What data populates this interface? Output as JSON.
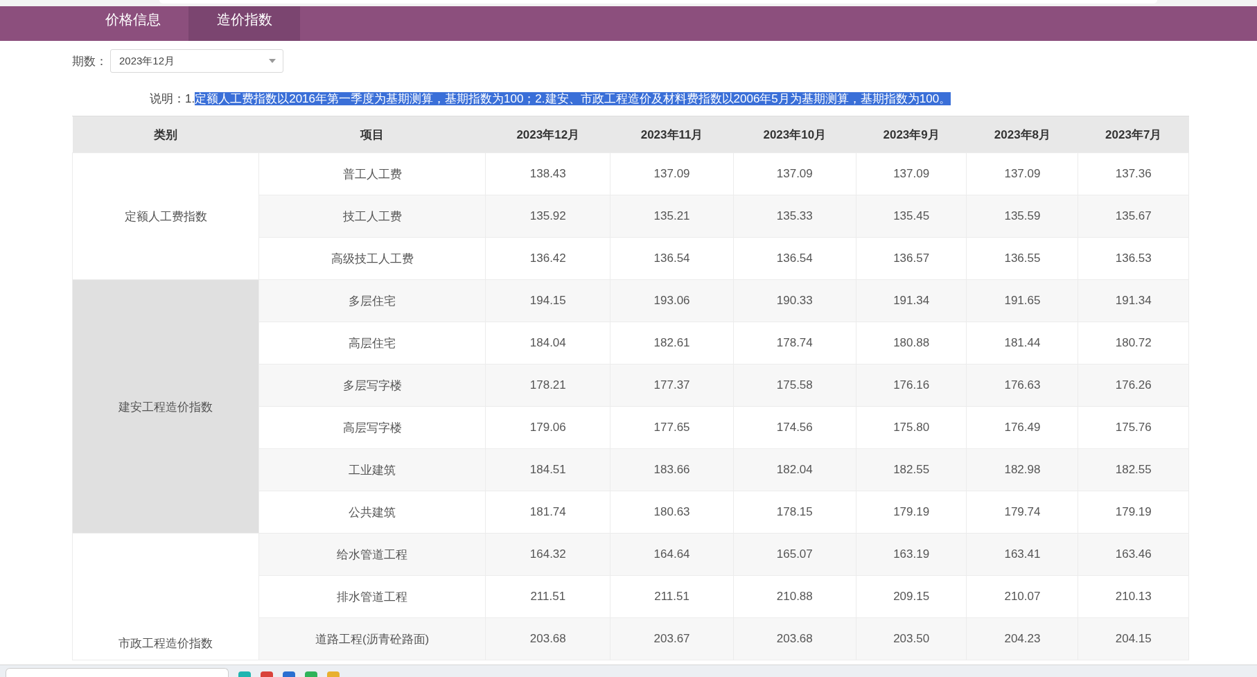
{
  "nav": {
    "tabs": [
      {
        "label": "价格信息",
        "selected": false
      },
      {
        "label": "造价指数",
        "selected": true
      }
    ]
  },
  "period": {
    "label": "期数：",
    "value": "2023年12月"
  },
  "note": {
    "label": "说明：",
    "plain": "1.",
    "selected_text": "定额人工费指数以2016年第一季度为基期测算，基期指数为100；2.建安、市政工程造价及材料费指数以2006年5月为基期测算，基期指数为100。"
  },
  "table": {
    "columns": [
      "类别",
      "项目",
      "2023年12月",
      "2023年11月",
      "2023年10月",
      "2023年9月",
      "2023年8月",
      "2023年7月"
    ],
    "groups": [
      {
        "category": "定额人工费指数",
        "shaded": false,
        "continues": false,
        "rows": [
          {
            "item": "普工人工费",
            "values": [
              "138.43",
              "137.09",
              "137.09",
              "137.09",
              "137.09",
              "137.36"
            ]
          },
          {
            "item": "技工人工费",
            "values": [
              "135.92",
              "135.21",
              "135.33",
              "135.45",
              "135.59",
              "135.67"
            ]
          },
          {
            "item": "高级技工人工费",
            "values": [
              "136.42",
              "136.54",
              "136.54",
              "136.57",
              "136.55",
              "136.53"
            ]
          }
        ]
      },
      {
        "category": "建安工程造价指数",
        "shaded": true,
        "continues": false,
        "rows": [
          {
            "item": "多层住宅",
            "values": [
              "194.15",
              "193.06",
              "190.33",
              "191.34",
              "191.65",
              "191.34"
            ]
          },
          {
            "item": "高层住宅",
            "values": [
              "184.04",
              "182.61",
              "178.74",
              "180.88",
              "181.44",
              "180.72"
            ]
          },
          {
            "item": "多层写字楼",
            "values": [
              "178.21",
              "177.37",
              "175.58",
              "176.16",
              "176.63",
              "176.26"
            ]
          },
          {
            "item": "高层写字楼",
            "values": [
              "179.06",
              "177.65",
              "174.56",
              "175.80",
              "176.49",
              "175.76"
            ]
          },
          {
            "item": "工业建筑",
            "values": [
              "184.51",
              "183.66",
              "182.04",
              "182.55",
              "182.98",
              "182.55"
            ]
          },
          {
            "item": "公共建筑",
            "values": [
              "181.74",
              "180.63",
              "178.15",
              "179.19",
              "179.74",
              "179.19"
            ]
          }
        ]
      },
      {
        "category": "市政工程造价指数",
        "shaded": false,
        "continues": true,
        "rows": [
          {
            "item": "给水管道工程",
            "values": [
              "164.32",
              "164.64",
              "165.07",
              "163.19",
              "163.41",
              "163.46"
            ]
          },
          {
            "item": "排水管道工程",
            "values": [
              "211.51",
              "211.51",
              "210.88",
              "209.15",
              "210.07",
              "210.13"
            ]
          },
          {
            "item": "道路工程(沥青砼路面)",
            "values": [
              "203.68",
              "203.67",
              "203.68",
              "203.50",
              "204.23",
              "204.15"
            ]
          }
        ]
      }
    ]
  }
}
